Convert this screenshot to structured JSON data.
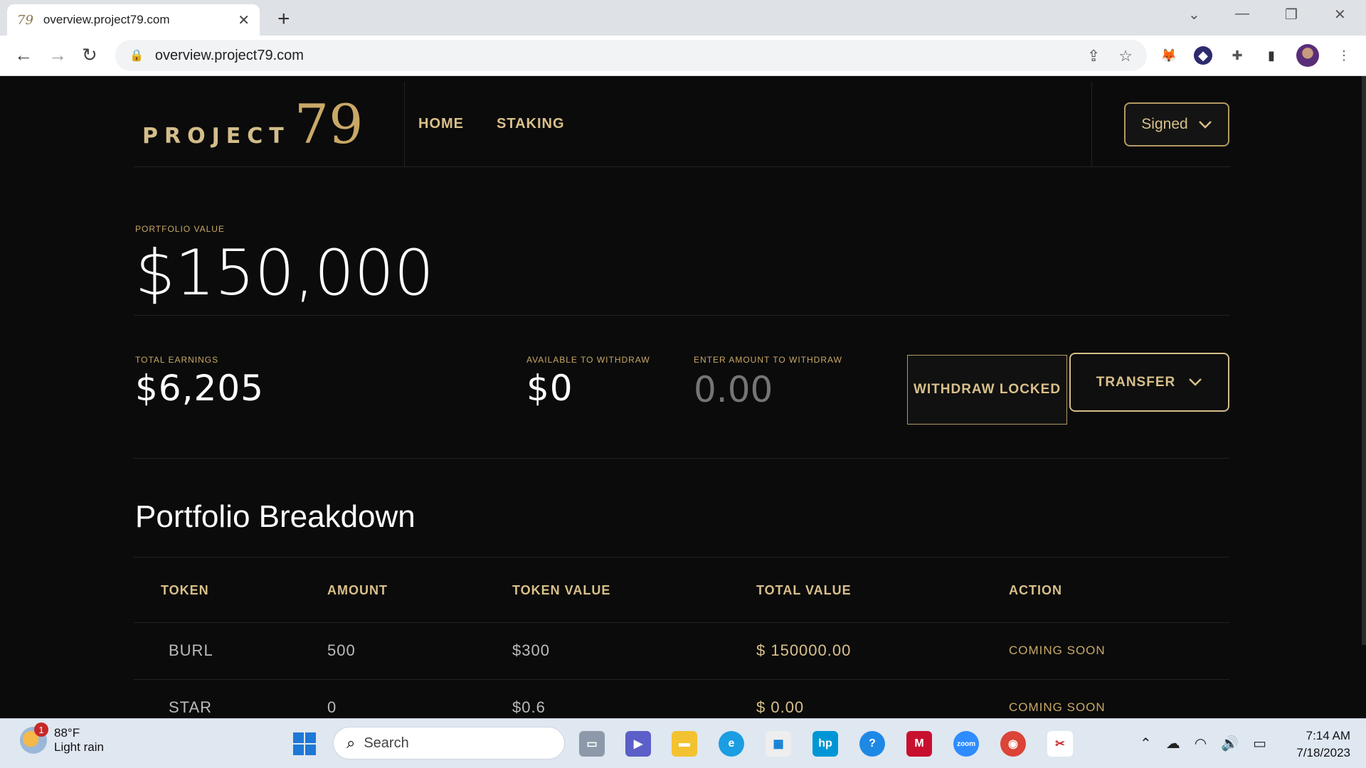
{
  "browser": {
    "tab_favicon": "79",
    "tab_title": "overview.project79.com",
    "url": "overview.project79.com"
  },
  "site": {
    "logo_text": "PROJECT",
    "logo_number": "79",
    "nav": [
      "HOME",
      "STAKING"
    ],
    "signed_label": "Signed"
  },
  "portfolio": {
    "value_label": "PORTFOLIO VALUE",
    "value": "$150,000",
    "earnings_label": "TOTAL EARNINGS",
    "earnings": "$6,205",
    "available_label": "AVAILABLE TO WITHDRAW",
    "available": "$0",
    "withdraw_input_label": "ENTER AMOUNT TO WITHDRAW",
    "withdraw_placeholder": "0.00",
    "withdraw_button": "WITHDRAW LOCKED",
    "transfer_button": "TRANSFER"
  },
  "breakdown": {
    "title": "Portfolio Breakdown",
    "columns": [
      "TOKEN",
      "AMOUNT",
      "TOKEN VALUE",
      "TOTAL VALUE",
      "ACTION"
    ],
    "rows": [
      {
        "token": "BURL",
        "amount": "500",
        "token_value": "$300",
        "total_value": "$ 150000.00",
        "action": "COMING SOON"
      },
      {
        "token": "STAR",
        "amount": "0",
        "token_value": "$0.6",
        "total_value": "$ 0.00",
        "action": "COMING SOON"
      }
    ]
  },
  "taskbar": {
    "weather_badge": "1",
    "temperature": "88°F",
    "weather_desc": "Light rain",
    "search_placeholder": "Search",
    "time": "7:14 AM",
    "date": "7/18/2023"
  }
}
